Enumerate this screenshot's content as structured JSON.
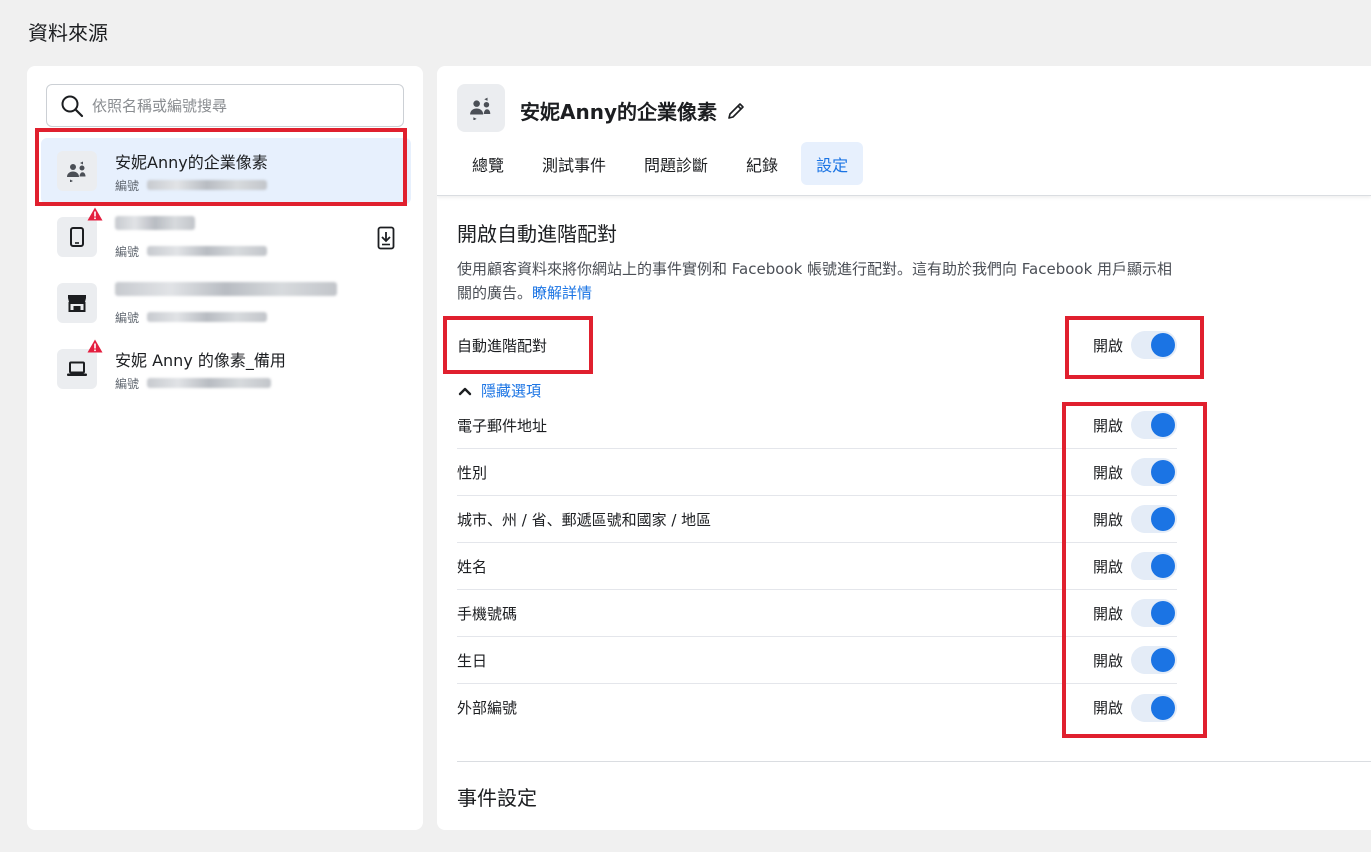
{
  "page": {
    "title": "資料來源"
  },
  "search": {
    "placeholder": "依照名稱或編號搜尋"
  },
  "sources": [
    {
      "name": "安妮Anny的企業像素",
      "id_label": "編號",
      "icon": "pixel-people-icon",
      "selected": true,
      "warning": false
    },
    {
      "name": "",
      "id_label": "編號",
      "icon": "mobile-app-icon",
      "selected": false,
      "warning": true
    },
    {
      "name": "",
      "id_label": "編號",
      "icon": "offline-store-icon",
      "selected": false,
      "warning": false
    },
    {
      "name": "安妮 Anny 的像素_備用",
      "id_label": "編號",
      "icon": "laptop-icon",
      "selected": false,
      "warning": true
    }
  ],
  "detail": {
    "title": "安妮Anny的企業像素",
    "tabs": [
      "總覽",
      "測試事件",
      "問題診斷",
      "紀錄",
      "設定"
    ],
    "active_tab": "設定"
  },
  "amm": {
    "title": "開啟自動進階配對",
    "description": "使用顧客資料來將你網站上的事件實例和 Facebook 帳號進行配對。這有助於我們向 Facebook 用戶顯示相關的廣告。",
    "learn_more": "瞭解詳情",
    "main_toggle_label": "自動進階配對",
    "toggle_state_label": "開啟",
    "hide_options": "隱藏選項",
    "options": [
      {
        "label": "電子郵件地址",
        "state": "開啟",
        "on": true
      },
      {
        "label": "性別",
        "state": "開啟",
        "on": true
      },
      {
        "label": "城市、州 / 省、郵遞區號和國家 / 地區",
        "state": "開啟",
        "on": true
      },
      {
        "label": "姓名",
        "state": "開啟",
        "on": true
      },
      {
        "label": "手機號碼",
        "state": "開啟",
        "on": true
      },
      {
        "label": "生日",
        "state": "開啟",
        "on": true
      },
      {
        "label": "外部編號",
        "state": "開啟",
        "on": true
      }
    ]
  },
  "events": {
    "title": "事件設定"
  },
  "colors": {
    "accent": "#1b74e4",
    "highlight": "#e0202e",
    "selected_bg": "#e7f0fd",
    "warning": "#e41e3f"
  }
}
